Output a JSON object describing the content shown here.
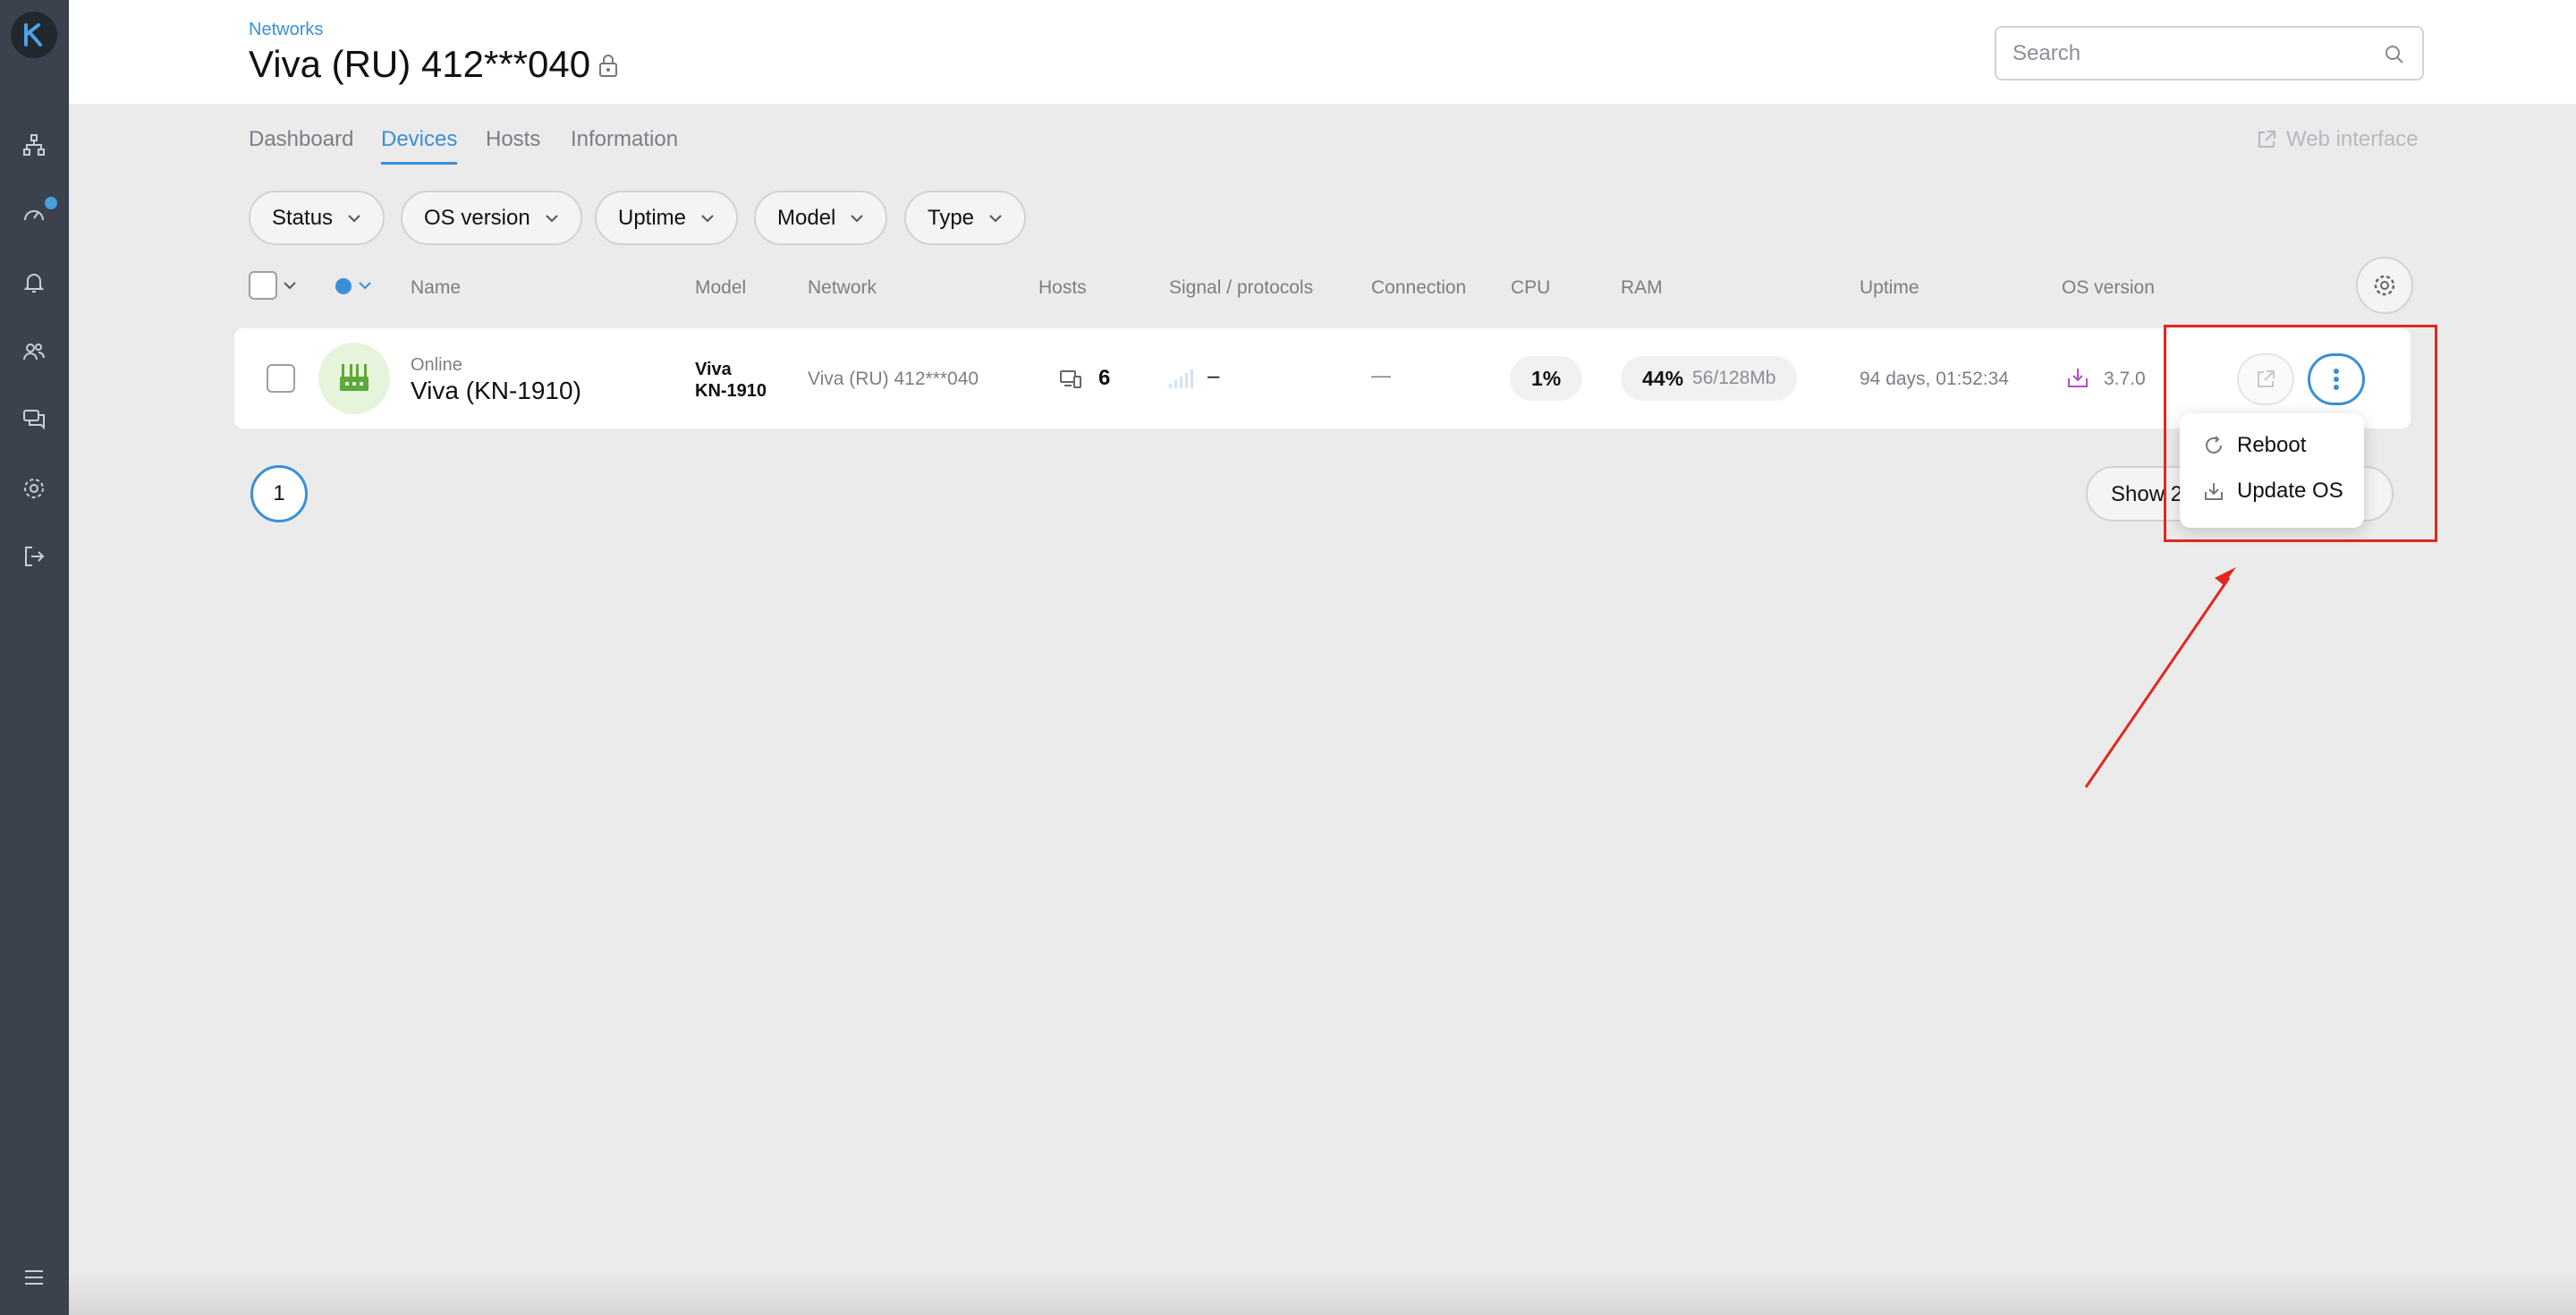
{
  "app": {
    "logo_letter": "K"
  },
  "sidebar": {
    "items": [
      {
        "icon": "network-icon"
      },
      {
        "icon": "dashboard-gauge-icon",
        "has_notification": true
      },
      {
        "icon": "bell-icon"
      },
      {
        "icon": "users-icon"
      },
      {
        "icon": "chat-icon"
      },
      {
        "icon": "gear-icon"
      },
      {
        "icon": "logout-icon"
      }
    ],
    "menu_icon": "hamburger-icon"
  },
  "header": {
    "breadcrumb": "Networks",
    "title": "Viva (RU) 412***040",
    "search_placeholder": "Search"
  },
  "tabs": [
    {
      "label": "Dashboard",
      "active": false
    },
    {
      "label": "Devices",
      "active": true
    },
    {
      "label": "Hosts",
      "active": false
    },
    {
      "label": "Information",
      "active": false
    }
  ],
  "web_interface_label": "Web interface",
  "filters": [
    "Status",
    "OS version",
    "Uptime",
    "Model",
    "Type"
  ],
  "columns": {
    "name": "Name",
    "model": "Model",
    "network": "Network",
    "hosts": "Hosts",
    "signal": "Signal / protocols",
    "connection": "Connection",
    "cpu": "CPU",
    "ram": "RAM",
    "uptime": "Uptime",
    "os_version": "OS version"
  },
  "device": {
    "status": "Online",
    "name": "Viva (KN-1910)",
    "model_line1": "Viva",
    "model_line2": "KN-1910",
    "network": "Viva (RU) 412***040",
    "hosts": "6",
    "signal": "–",
    "connection": "—",
    "cpu": "1%",
    "ram_percent": "44%",
    "ram_detail": "56/128Mb",
    "uptime": "94 days, 01:52:34",
    "os_version": "3.7.0"
  },
  "pagination": {
    "current_page": "1",
    "show_label": "Show 2"
  },
  "menu": {
    "reboot": "Reboot",
    "update_os": "Update OS"
  },
  "colors": {
    "accent": "#3a8fd6",
    "sidebar": "#3c424d",
    "annotation": "#e0281f",
    "os_update_icon": "#b04fc4",
    "device_icon": "#5fa83a"
  }
}
